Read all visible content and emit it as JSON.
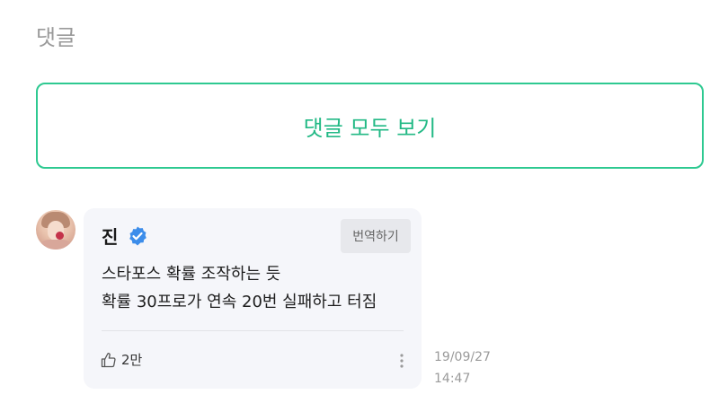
{
  "section": {
    "title": "댓글"
  },
  "view_all": {
    "label": "댓글 모두 보기"
  },
  "comment": {
    "author": "진",
    "translate_label": "번역하기",
    "lines": [
      "스타포스 확률 조작하는 듯",
      "확률 30프로가 연속 20번 실패하고 터짐"
    ],
    "like_count": "2만",
    "date": "19/09/27",
    "time": "14:47"
  },
  "colors": {
    "accent": "#2ec991",
    "verified": "#3c8dea",
    "bubble": "#f5f6fa"
  },
  "icons": {
    "verified": "verified-badge-icon",
    "like": "thumbs-up-icon",
    "more": "more-vertical-icon"
  }
}
